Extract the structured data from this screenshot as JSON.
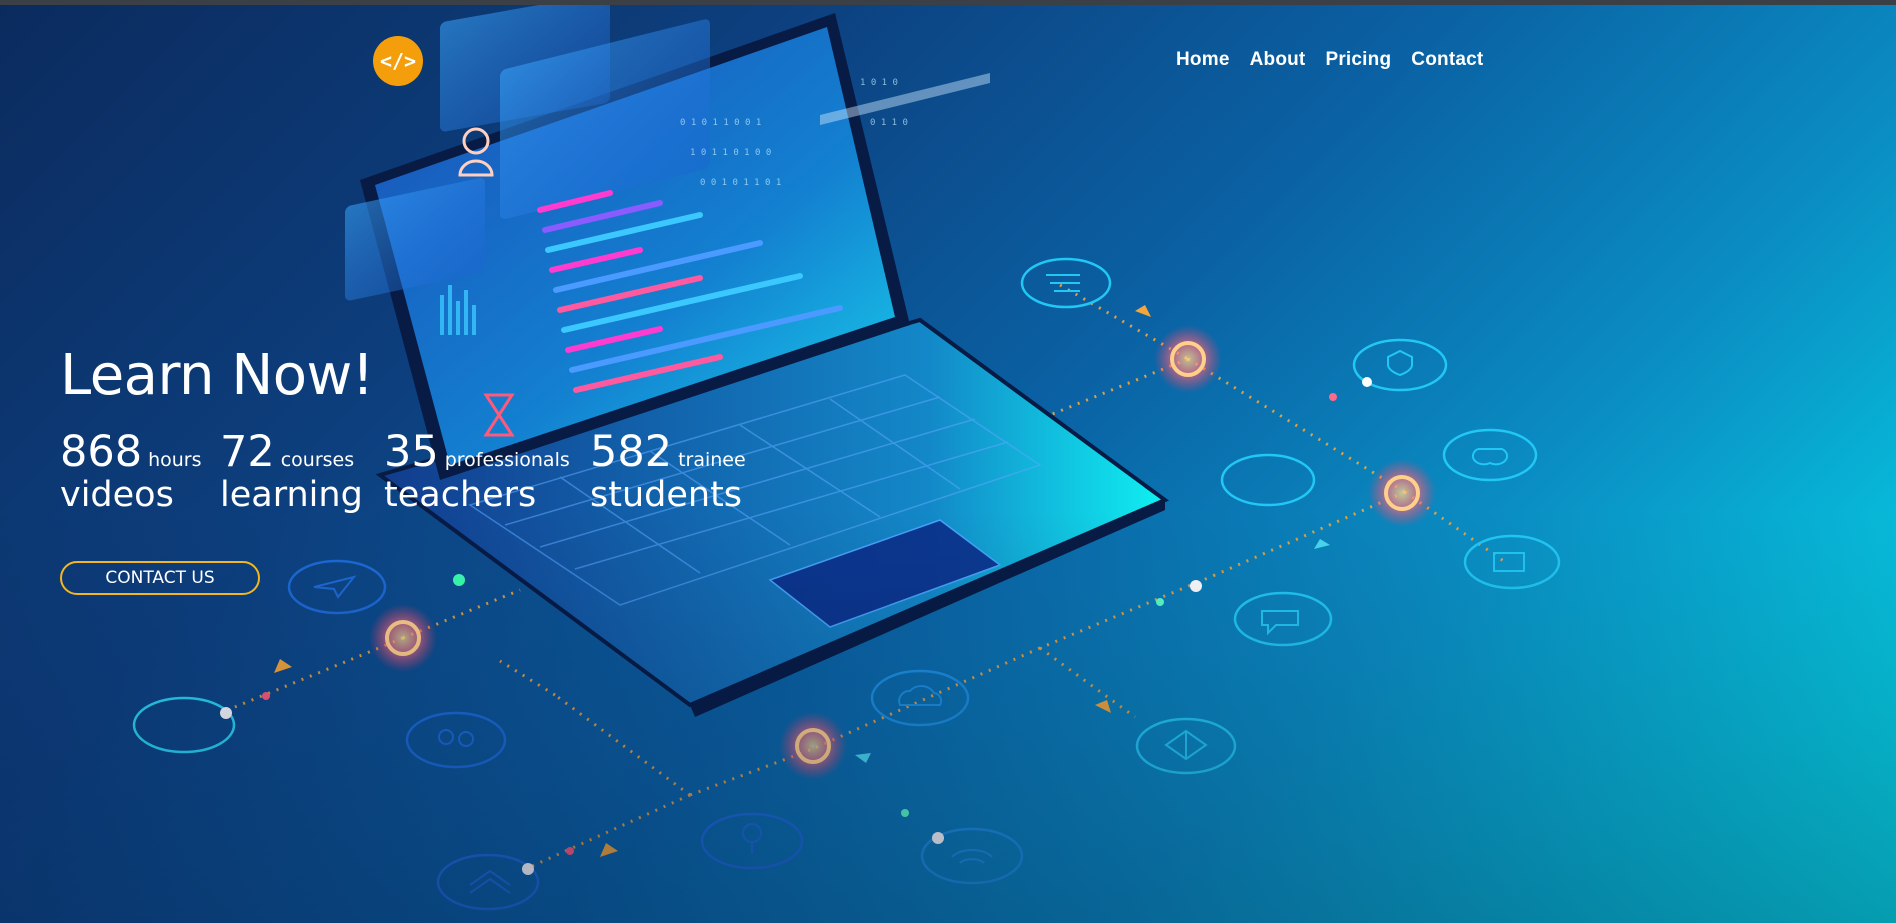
{
  "logo": {
    "glyph": "</>",
    "color": "#f59e0b"
  },
  "nav": {
    "items": [
      "Home",
      "About",
      "Pricing",
      "Contact"
    ]
  },
  "hero": {
    "headline": "Learn Now!",
    "stats": [
      {
        "number": "868",
        "unit": "hours",
        "label": "videos"
      },
      {
        "number": "72",
        "unit": "courses",
        "label": "learning"
      },
      {
        "number": "35",
        "unit": "professionals",
        "label": "teachers"
      },
      {
        "number": "582",
        "unit": "trainee",
        "label": "students"
      }
    ],
    "cta_label": "CONTACT US",
    "cta_border_color": "#f2b71f"
  },
  "illustration": {
    "subject": "isometric laptop with code screens and connected network icons",
    "icons": [
      "list-icon",
      "shield-icon",
      "location-icon",
      "image-icon",
      "camera-icon",
      "chat-icon",
      "cloud-icon",
      "cube-icon",
      "wifi-icon",
      "search-icon",
      "book-stack-icon",
      "group-icon",
      "calculator-icon",
      "cursor-icon"
    ]
  }
}
